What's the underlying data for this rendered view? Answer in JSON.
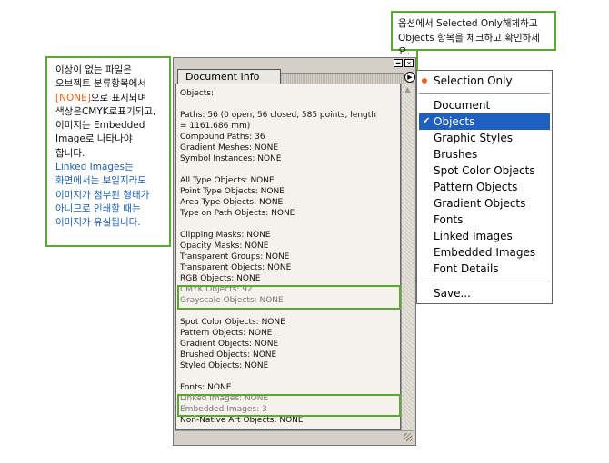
{
  "left_note": {
    "line1": "이상이 없는 파일은",
    "line2": "오브젝트 분류항목에서",
    "line3a": "[NONE]",
    "line3b": "으로 표시되며",
    "line4": "색상은CMYK로표기되고,",
    "line5": "이미지는 Embedded",
    "line6": "Image로 나타나야",
    "line7": "합니다.",
    "line8": "Linked Images는",
    "line9": "화면에서는 보일지라도",
    "line10": "이미지가 첨부된 형태가",
    "line11": "아니므로 인쇄할 때는",
    "line12": "이미지가 유실됩니다."
  },
  "top_note": {
    "line1": "옵션에서 Selected Only해체하고",
    "line2": "Objects 항목을 체크하고 확인하세요."
  },
  "panel": {
    "tab_label": "Document Info",
    "minimize_glyph": "▬",
    "close_glyph": "✕",
    "menu_arrow_glyph": "▶",
    "scroll_up_glyph": "▲",
    "lines": [
      "Objects:",
      "",
      "Paths: 56 (0 open, 56 closed, 585 points, length",
      "= 1161.686 mm)",
      "Compound Paths: 36",
      "Gradient Meshes: NONE",
      "Symbol Instances: NONE",
      "",
      "All Type Objects: NONE",
      "Point Type Objects: NONE",
      "Area Type Objects: NONE",
      "Type on Path Objects: NONE",
      "",
      "Clipping Masks: NONE",
      "Opacity Masks: NONE",
      "Transparent Groups: NONE",
      "Transparent Objects: NONE",
      "RGB Objects: NONE",
      "CMYK Objects: 92",
      "Grayscale Objects: NONE",
      "",
      "Spot Color Objects: NONE",
      "Pattern Objects: NONE",
      "Gradient Objects: NONE",
      "Brushed Objects: NONE",
      "Styled Objects: NONE",
      "",
      "Fonts: NONE",
      "Linked Images: NONE",
      "Embedded Images: 3",
      "Non-Native Art Objects: NONE"
    ]
  },
  "menu": {
    "check_glyph": "✔",
    "selection_only": "Selection Only",
    "items": [
      "Document",
      "Objects",
      "Graphic Styles",
      "Brushes",
      "Spot Color Objects",
      "Pattern Objects",
      "Gradient Objects",
      "Fonts",
      "Linked Images",
      "Embedded Images",
      "Font Details"
    ],
    "save": "Save..."
  },
  "colors": {
    "highlight_green": "#5aa832",
    "menu_selected": "#1f5fbf",
    "accent_orange": "#e8641e"
  }
}
